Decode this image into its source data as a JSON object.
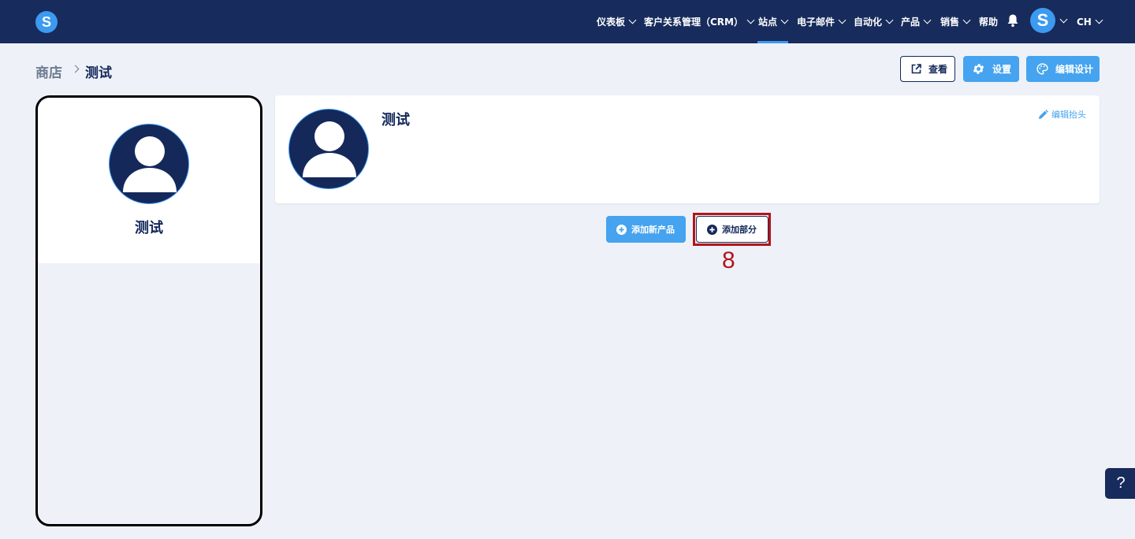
{
  "app": {
    "logo_letter": "S"
  },
  "nav": {
    "items": [
      {
        "label": "仪表板"
      },
      {
        "label": "客户关系管理（CRM）"
      },
      {
        "label": "站点"
      },
      {
        "label": "电子邮件"
      },
      {
        "label": "自动化"
      },
      {
        "label": "产品"
      },
      {
        "label": "销售"
      },
      {
        "label": "帮助"
      }
    ],
    "active": "站点",
    "user_initial": "S",
    "language": "CH"
  },
  "breadcrumb": {
    "parent": "商店",
    "current": "测试"
  },
  "toolbar": {
    "view_label": "查看",
    "settings_label": "设置",
    "edit_design_label": "编辑设计"
  },
  "preview": {
    "store_name": "测试"
  },
  "header_card": {
    "store_name": "测试",
    "edit_header_label": "编辑抬头"
  },
  "actions": {
    "add_product_label": "添加新产品",
    "add_section_label": "添加部分"
  },
  "annotation": {
    "step_number": "8"
  },
  "help": {
    "label": "?"
  },
  "colors": {
    "nav_bg": "#172b5c",
    "accent": "#45a3ef",
    "highlight": "#b3151a",
    "page_bg": "#eef2f8"
  }
}
